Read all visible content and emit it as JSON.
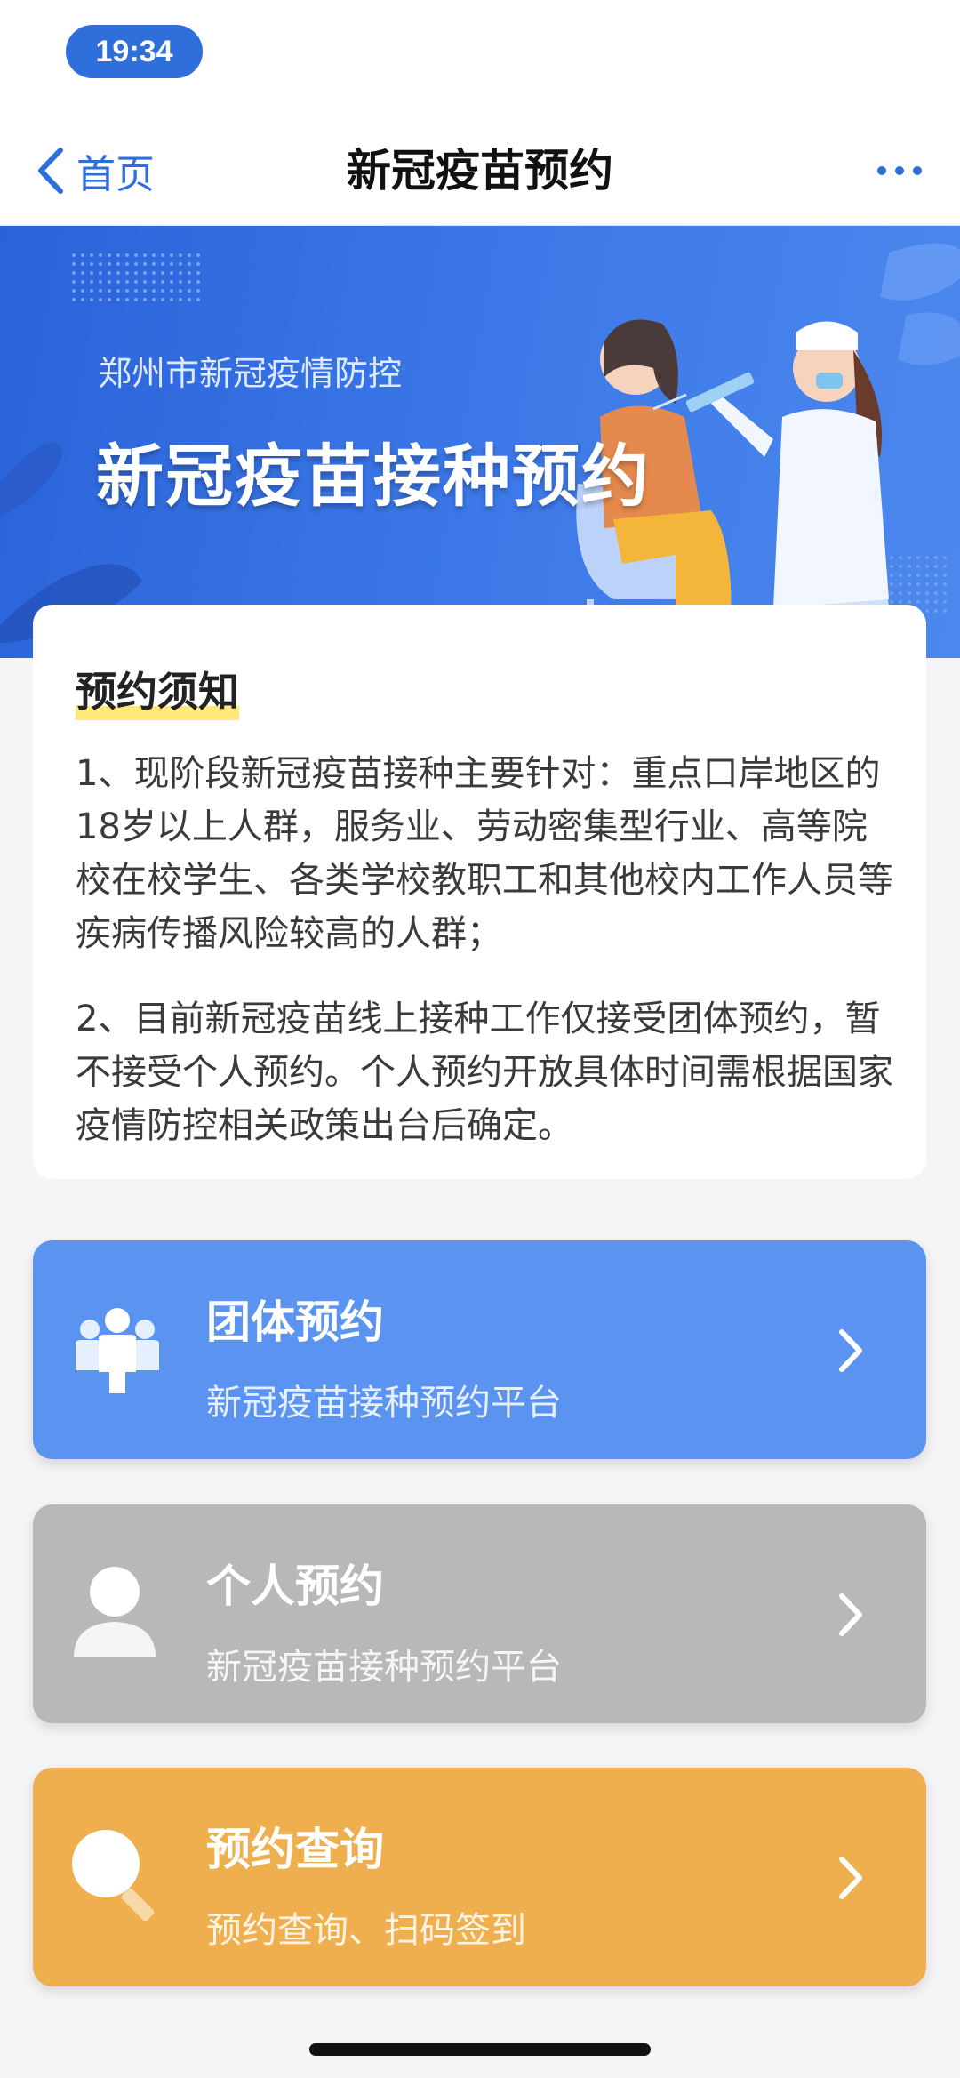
{
  "status_bar": {
    "time": "19:34"
  },
  "nav": {
    "back_label": "首页",
    "title": "新冠疫苗预约",
    "more_icon": "more-icon"
  },
  "banner": {
    "subtitle": "郑州市新冠疫情防控",
    "title": "新冠疫苗接种预约"
  },
  "notice": {
    "heading": "预约须知",
    "paragraphs": [
      "1、现阶段新冠疫苗接种主要针对：重点口岸地区的18岁以上人群，服务业、劳动密集型行业、高等院校在校学生、各类学校教职工和其他校内工作人员等疾病传播风险较高的人群；",
      "2、目前新冠疫苗线上接种工作仅接受团体预约，暂不接受个人预约。个人预约开放具体时间需根据国家疫情防控相关政策出台后确定。"
    ]
  },
  "actions": [
    {
      "title": "团体预约",
      "subtitle": "新冠疫苗接种预约平台",
      "icon": "group-icon",
      "color": "#5b93f0"
    },
    {
      "title": "个人预约",
      "subtitle": "新冠疫苗接种预约平台",
      "icon": "person-icon",
      "color": "#b8b8b8"
    },
    {
      "title": "预约查询",
      "subtitle": "预约查询、扫码签到",
      "icon": "search-icon",
      "color": "#efaf4f"
    }
  ],
  "colors": {
    "accent": "#2f6fdc",
    "banner": "#3d7ae8"
  }
}
